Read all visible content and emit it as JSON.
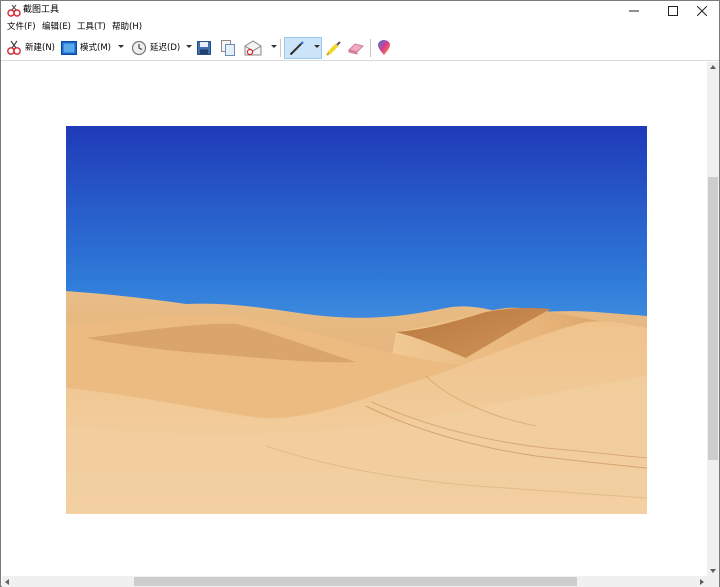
{
  "window": {
    "title": "截图工具",
    "icon": "scissors-snip-icon",
    "controls": [
      "minimize-icon",
      "maximize-icon",
      "close-icon"
    ]
  },
  "menubar": {
    "items": [
      {
        "label": "文件(F)"
      },
      {
        "label": "编辑(E)"
      },
      {
        "label": "工具(T)"
      },
      {
        "label": "帮助(H)"
      }
    ]
  },
  "toolbar": {
    "new_label": "新建(N)",
    "mode_label": "模式(M)",
    "delay_label": "延迟(D)",
    "icons": {
      "new": "new-snip-icon",
      "mode": "rectangle-mode-icon",
      "delay": "clock-icon",
      "save": "save-icon",
      "copy": "copy-icon",
      "send": "send-email-icon",
      "pen": "pen-icon",
      "highlighter": "highlighter-icon",
      "eraser": "eraser-icon",
      "paint3d": "paint-3d-icon"
    },
    "active_tool": "pen"
  },
  "canvas": {
    "content": "captured-image-desert-dunes",
    "colors": {
      "sky_top": "#1f3ab8",
      "sky_bottom": "#7ec4ee",
      "sand_light": "#f0c894",
      "sand_shadow": "#c48a52"
    }
  }
}
